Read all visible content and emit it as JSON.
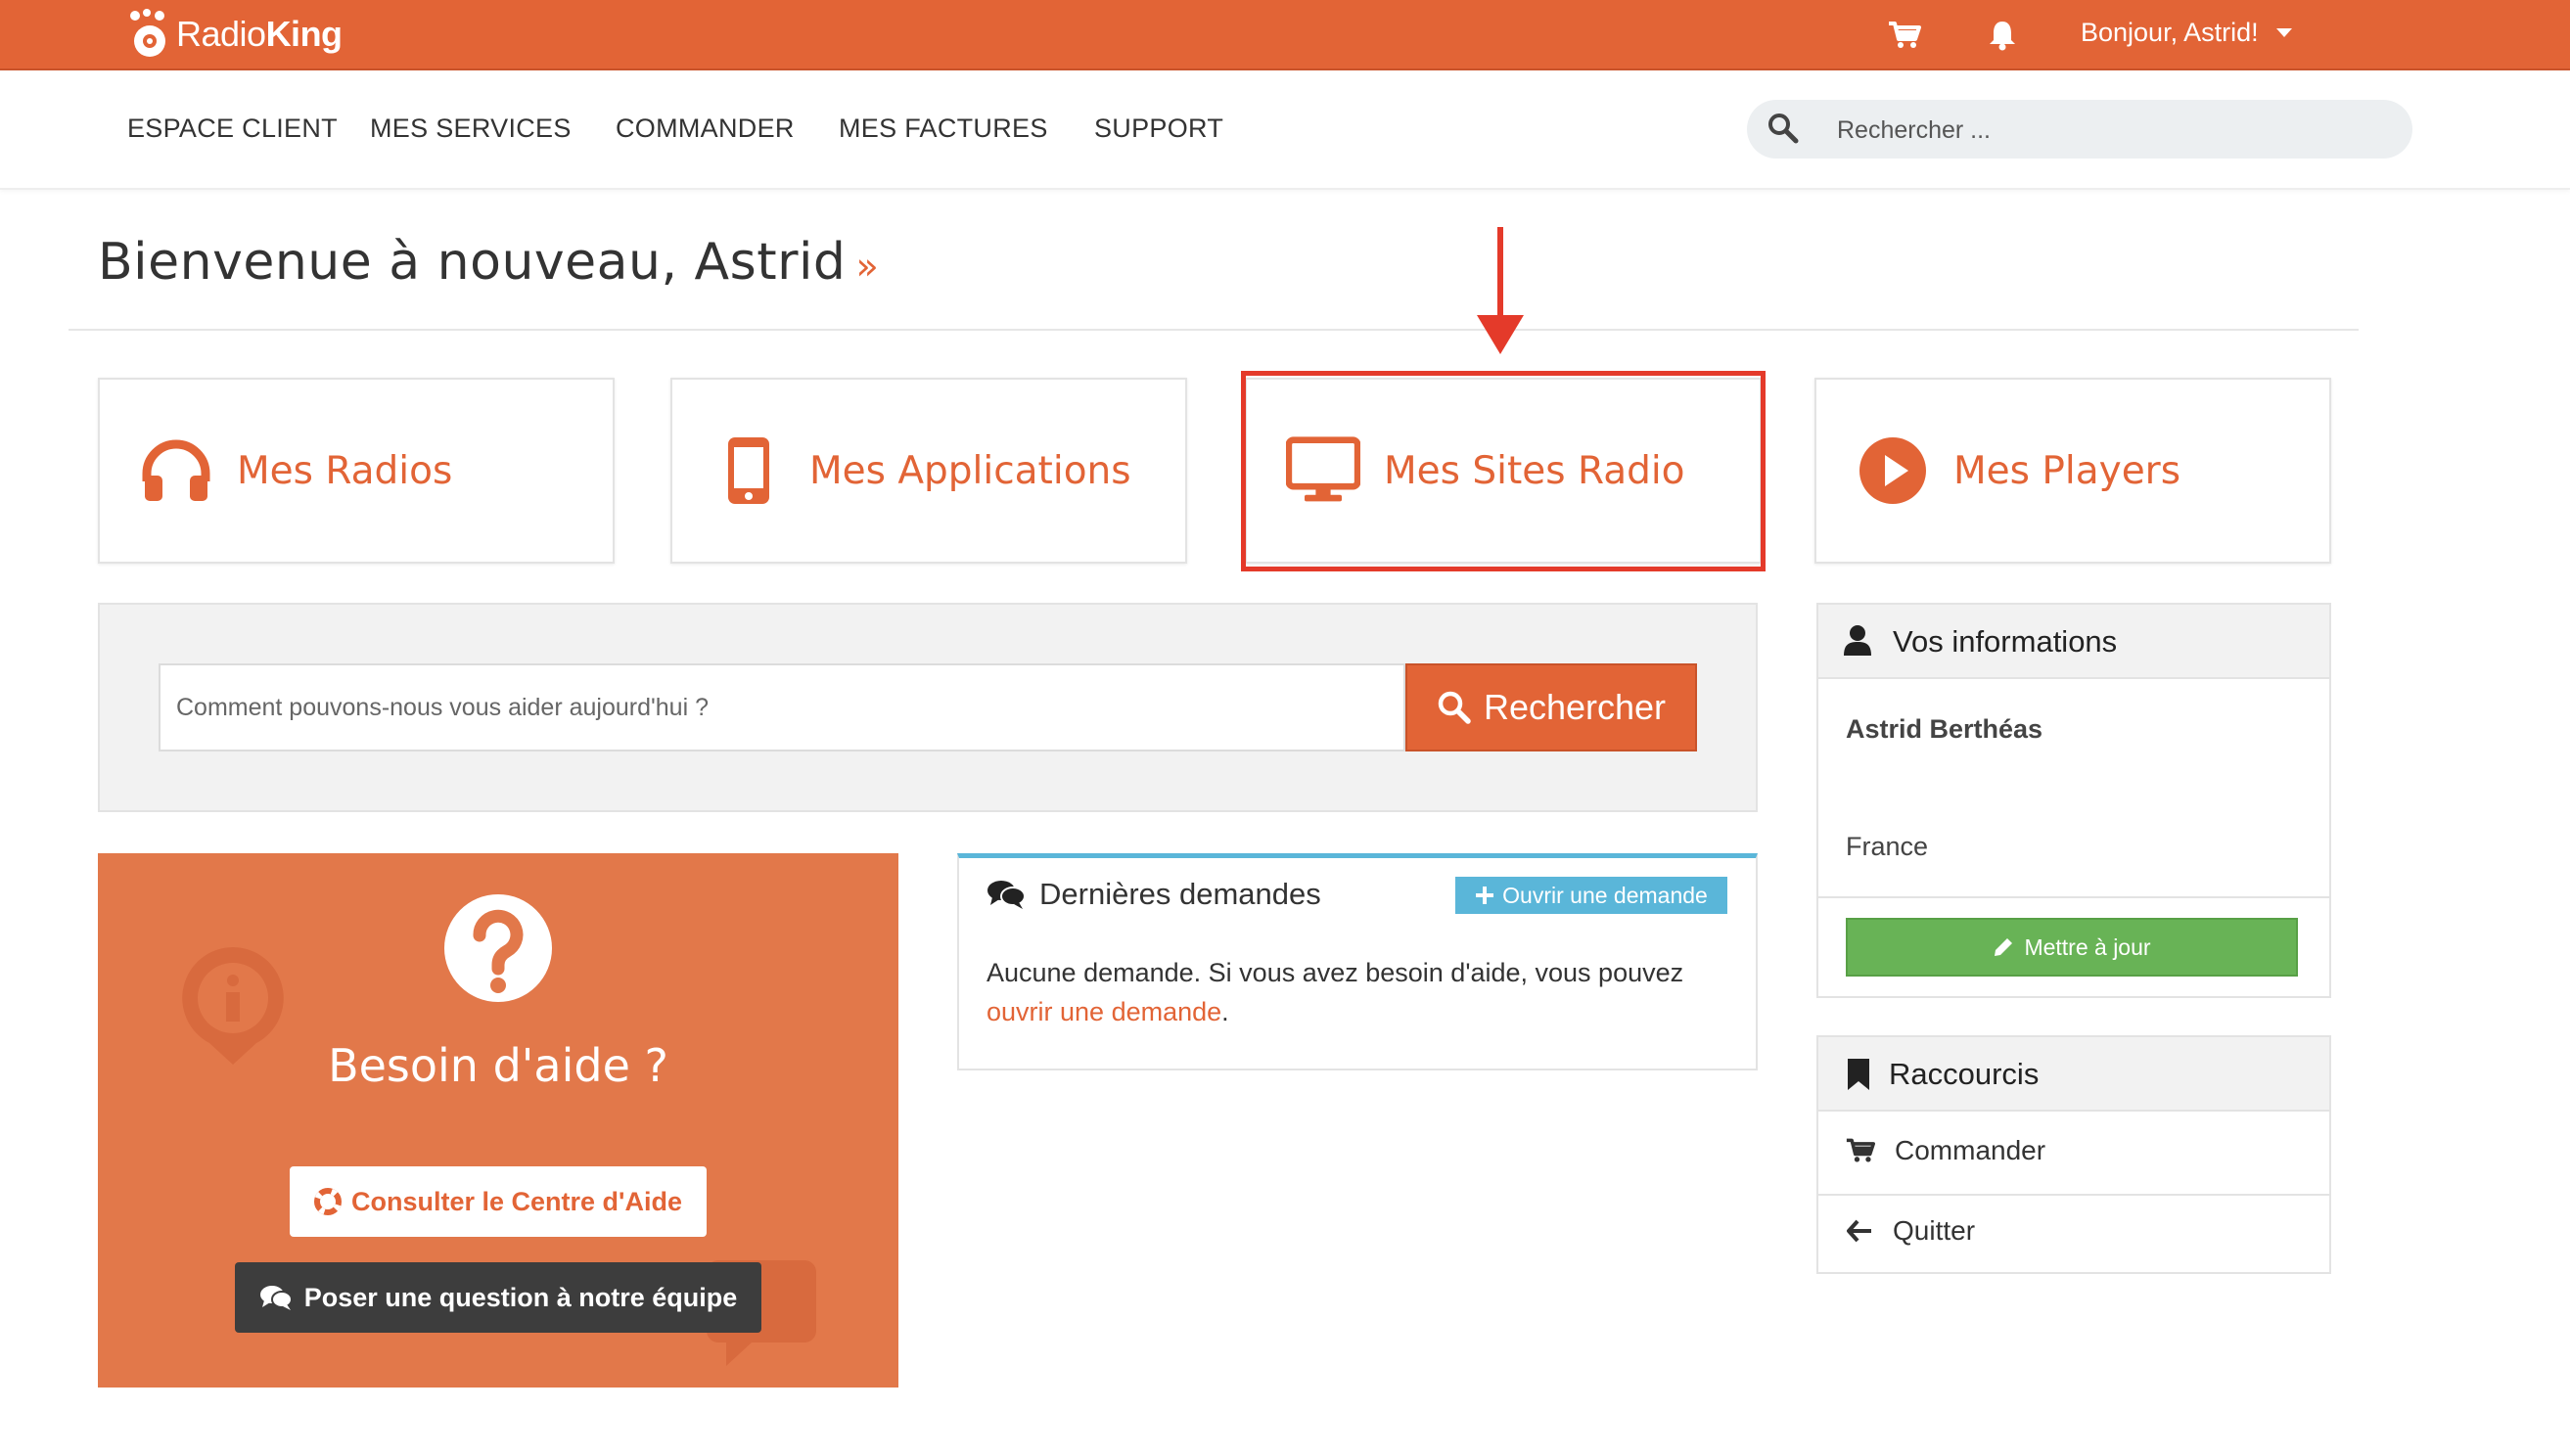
{
  "brand": {
    "name_light": "Radio",
    "name_bold": "King"
  },
  "topbar": {
    "greeting": "Bonjour, Astrid!"
  },
  "nav": {
    "items": [
      "ESPACE CLIENT",
      "MES SERVICES",
      "COMMANDER",
      "MES FACTURES",
      "SUPPORT"
    ]
  },
  "search": {
    "placeholder": "Rechercher ..."
  },
  "welcome": {
    "title": "Bienvenue à nouveau, Astrid",
    "suffix": "»"
  },
  "tiles": [
    {
      "label": "Mes Radios",
      "icon": "headphones-icon"
    },
    {
      "label": "Mes Applications",
      "icon": "mobile-icon"
    },
    {
      "label": "Mes Sites Radio",
      "icon": "desktop-icon"
    },
    {
      "label": "Mes Players",
      "icon": "play-circle-icon"
    }
  ],
  "help_search": {
    "placeholder": "Comment pouvons-nous vous aider aujourd'hui ?",
    "button": "Rechercher"
  },
  "help_panel": {
    "title": "Besoin d'aide ?",
    "help_center_button": "Consulter le Centre d'Aide",
    "ask_button": "Poser une question à notre équipe"
  },
  "tickets": {
    "title": "Dernières demandes",
    "open_button": "Ouvrir une demande",
    "empty_text": "Aucune demande. Si vous avez besoin d'aide, vous pouvez",
    "empty_link": "ouvrir une demande",
    "empty_end": "."
  },
  "user_info": {
    "title": "Vos informations",
    "name": "Astrid Berthéas",
    "country": "France",
    "update_button": "Mettre à jour"
  },
  "shortcuts": {
    "title": "Raccourcis",
    "items": [
      "Commander",
      "Quitter"
    ]
  },
  "colors": {
    "accent": "#e26436",
    "highlight": "#e43a2a",
    "info": "#5ab6d9",
    "success": "#68b356"
  }
}
